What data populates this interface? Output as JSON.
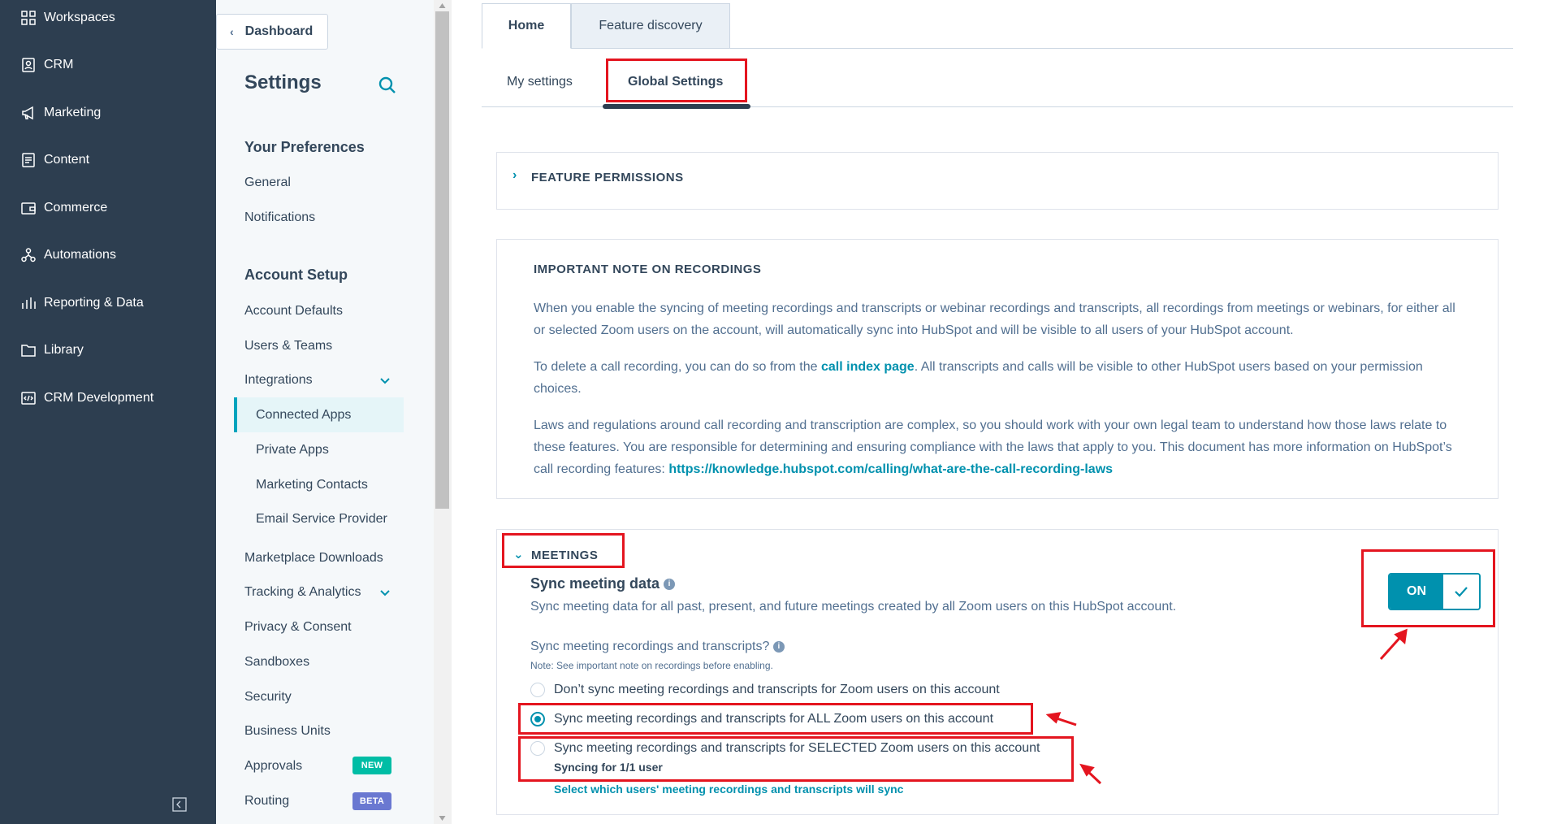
{
  "nav": {
    "items": [
      {
        "label": "Workspaces",
        "icon": "grid-icon"
      },
      {
        "label": "CRM",
        "icon": "contacts-icon"
      },
      {
        "label": "Marketing",
        "icon": "megaphone-icon"
      },
      {
        "label": "Content",
        "icon": "document-icon"
      },
      {
        "label": "Commerce",
        "icon": "wallet-icon"
      },
      {
        "label": "Automations",
        "icon": "workflow-icon"
      },
      {
        "label": "Reporting & Data",
        "icon": "bar-chart-icon"
      },
      {
        "label": "Library",
        "icon": "folder-icon"
      },
      {
        "label": "CRM Development",
        "icon": "code-icon"
      }
    ]
  },
  "sidebar": {
    "back_label": "Dashboard",
    "title": "Settings",
    "preferences_heading": "Your Preferences",
    "preferences": [
      "General",
      "Notifications"
    ],
    "account_heading": "Account Setup",
    "account_items": [
      "Account Defaults",
      "Users & Teams",
      "Integrations"
    ],
    "integrations_sub": [
      "Connected Apps",
      "Private Apps",
      "Marketing Contacts",
      "Email Service Provider"
    ],
    "more_items": [
      "Marketplace Downloads",
      "Tracking & Analytics",
      "Privacy & Consent",
      "Sandboxes",
      "Security",
      "Business Units",
      "Approvals",
      "Routing"
    ],
    "badge_new": "NEW",
    "badge_beta": "BETA",
    "active_item": "Connected Apps"
  },
  "tabs": {
    "home": "Home",
    "feature_discovery": "Feature discovery"
  },
  "subtabs": {
    "my_settings": "My settings",
    "global_settings": "Global Settings"
  },
  "feature_permissions": {
    "heading": "FEATURE PERMISSIONS"
  },
  "recordings_note": {
    "heading": "IMPORTANT NOTE ON RECORDINGS",
    "p1": "When you enable the syncing of meeting recordings and transcripts or webinar recordings and transcripts, all recordings from meetings or webinars, for either all or selected Zoom users on the account, will automatically sync into HubSpot and will be visible to all users of your HubSpot account.",
    "p2_before": "To delete a call recording, you can do so from the ",
    "p2_link": "call index page",
    "p2_after": ". All transcripts and calls will be visible to other HubSpot users based on your permission choices.",
    "p3_before": "Laws and regulations around call recording and transcription are complex, so you should work with your own legal team to understand how those laws relate to these features. You are responsible for determining and ensuring compliance with the laws that apply to you. This document has more information on HubSpot’s call recording features: ",
    "p3_link": "https://knowledge.hubspot.com/calling/what-are-the-call-recording-laws"
  },
  "meetings": {
    "heading": "MEETINGS",
    "sync_title": "Sync meeting data",
    "sync_desc": "Sync meeting data for all past, present, and future meetings created by all Zoom users on this HubSpot account.",
    "toggle_label": "ON",
    "recordings_question": "Sync meeting recordings and transcripts?",
    "note": "Note: See important note on recordings before enabling.",
    "options": [
      "Don’t sync meeting recordings and transcripts for Zoom users on this account",
      "Sync meeting recordings and transcripts for ALL Zoom users on this account",
      "Sync meeting recordings and transcripts for SELECTED Zoom users on this account"
    ],
    "selected_option": 1,
    "syncing_status": "Syncing for 1/1 user",
    "select_users_link": "Select which users' meeting recordings and transcripts will sync"
  },
  "colors": {
    "nav_bg": "#2d3e50",
    "accent": "#0091ae",
    "annotation": "#e4151f"
  }
}
